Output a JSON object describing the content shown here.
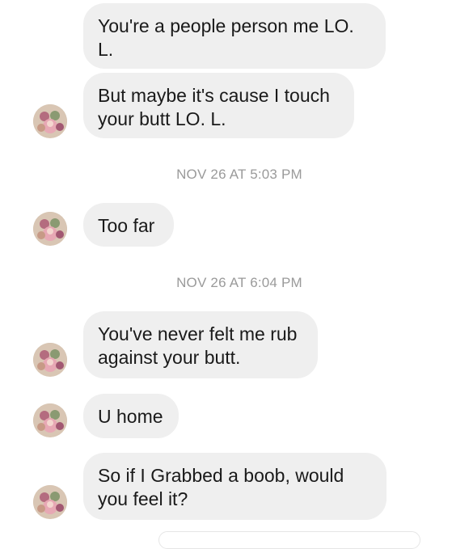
{
  "messages": [
    {
      "text": "You're a people person me LO.\nL."
    },
    {
      "text": "But maybe it's cause I touch\nyour butt LO. L."
    },
    {
      "text": "Too far"
    },
    {
      "text": "You've never felt me rub\nagainst your butt."
    },
    {
      "text": "U home"
    },
    {
      "text": "So if I Grabbed a boob, would\nyou feel it?"
    }
  ],
  "timestamps": [
    "NOV 26 AT 5:03 PM",
    "NOV 26 AT 6:04 PM"
  ],
  "icons": {
    "avatar": "contact-avatar-icon"
  },
  "colors": {
    "bubble_bg": "#efefef",
    "text": "#1a1a1a",
    "timestamp": "#9a9a9a",
    "background": "#ffffff"
  }
}
